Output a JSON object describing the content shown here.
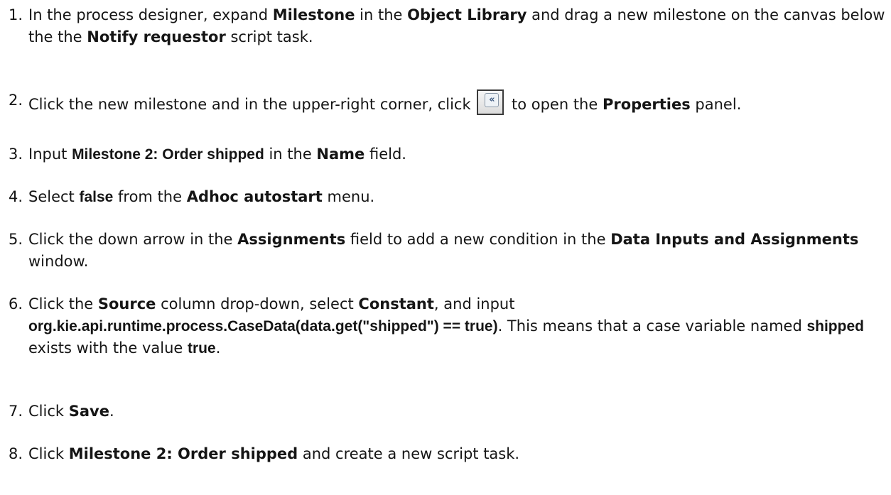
{
  "steps": [
    {
      "num": "1.",
      "p1": "In the process designer, expand ",
      "b1": "Milestone",
      "p2": " in the ",
      "b2": "Object Library",
      "p3": " and drag a new milestone on the canvas below the the ",
      "b3": "Notify requestor",
      "p4": " script task."
    },
    {
      "num": "2.",
      "p1": "Click the new milestone and in the upper-right corner, click ",
      "icon": "collapse-left-double-chevron-icon",
      "icon_glyph": "«",
      "p2": " to open the ",
      "b1": "Properties",
      "p3": " panel."
    },
    {
      "num": "3.",
      "p1": "Input ",
      "b1": "Milestone 2: Order shipped",
      "p2": " in the ",
      "b2": "Name",
      "p3": " field."
    },
    {
      "num": "4.",
      "p1": "Select ",
      "b1": "false",
      "p2": " from the ",
      "b2": "Adhoc autostart",
      "p3": " menu."
    },
    {
      "num": "5.",
      "p1": "Click the down arrow in the ",
      "b1": "Assignments",
      "p2": " field to add a new condition in the ",
      "b2": "Data Inputs and Assignments",
      "p3": " window."
    },
    {
      "num": "6.",
      "p1": "Click the ",
      "b1": "Source",
      "p2": " column drop-down, select ",
      "b2": "Constant",
      "p3": ", and input ",
      "b3": "org.kie.api.runtime.process.CaseData(data.get(\"shipped\") == true)",
      "p4": ". This means that a case variable named ",
      "b4": "shipped",
      "p5": " exists with the value ",
      "b5": "true",
      "p6": "."
    },
    {
      "num": "7.",
      "p1": "Click ",
      "b1": "Save",
      "p2": "."
    },
    {
      "num": "8.",
      "p1": "Click ",
      "b1": "Milestone 2: Order shipped",
      "p2": " and create a new script task."
    }
  ]
}
